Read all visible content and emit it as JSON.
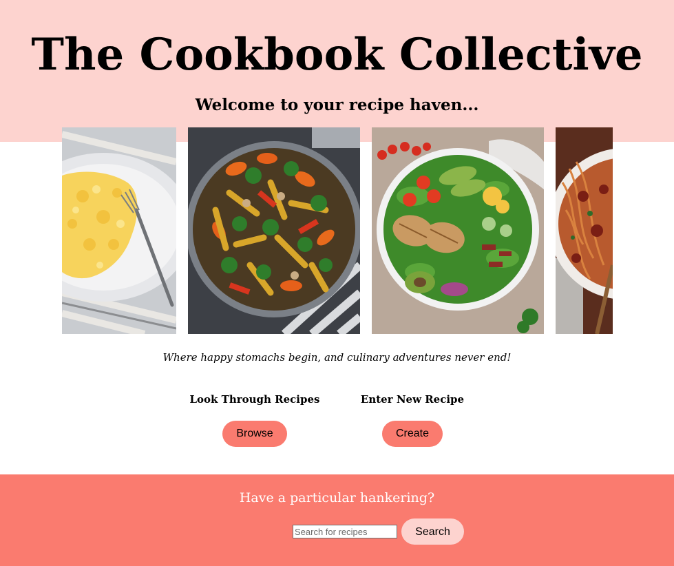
{
  "header": {
    "title": "The Cookbook Collective",
    "welcome": "Welcome to your recipe haven..."
  },
  "carousel": {
    "photos": [
      {
        "name": "scrambled-eggs-photo"
      },
      {
        "name": "stir-fry-vegetables-photo"
      },
      {
        "name": "chicken-salad-bowl-photo"
      },
      {
        "name": "spaghetti-photo"
      }
    ]
  },
  "tagline": "Where happy stomachs begin, and culinary adventures never end!",
  "actions": {
    "browse": {
      "heading": "Look Through Recipes",
      "button": "Browse"
    },
    "create": {
      "heading": "Enter New Recipe",
      "button": "Create"
    }
  },
  "footer": {
    "prompt": "Have a particular hankering?",
    "search_placeholder": "Search for recipes",
    "search_button": "Search"
  },
  "colors": {
    "hero_background": "#fdd3cf",
    "accent": "#fa7b6f",
    "footer_text": "#ffffff"
  }
}
